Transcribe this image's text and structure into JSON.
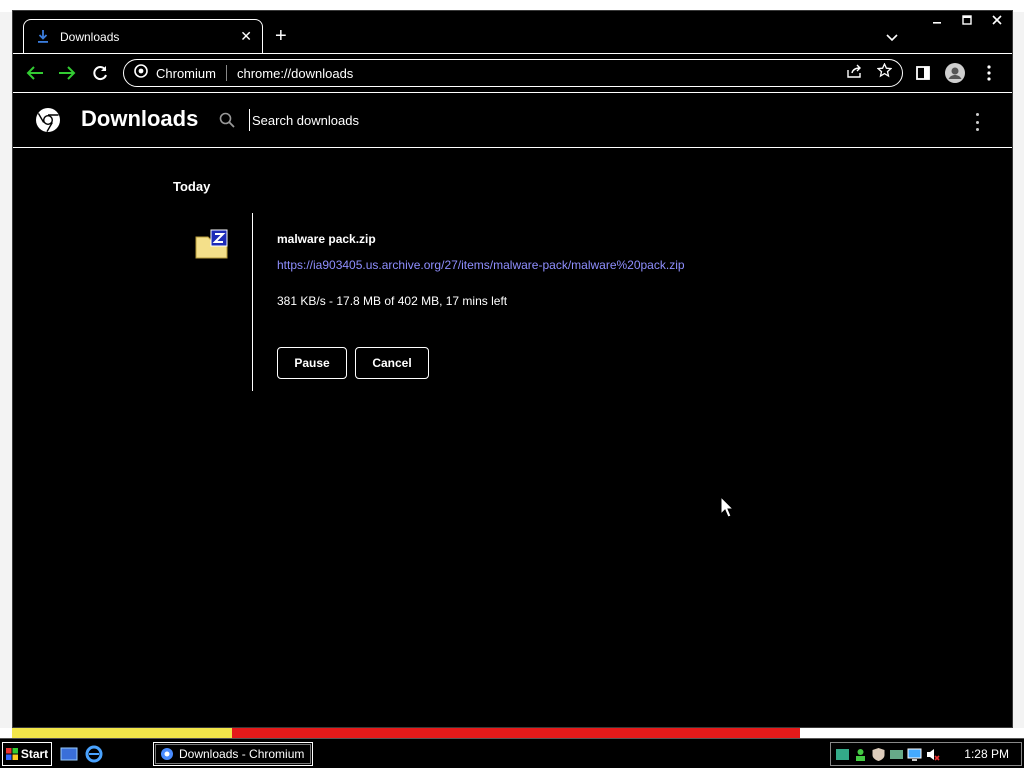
{
  "browser": {
    "tab_title": "Downloads",
    "site_name": "Chromium",
    "url": "chrome://downloads"
  },
  "downloads_page": {
    "title": "Downloads",
    "search_placeholder": "Search downloads",
    "date_group": "Today",
    "items": [
      {
        "file_name": "malware pack.zip",
        "url": "https://ia903405.us.archive.org/27/items/malware-pack/malware%20pack.zip",
        "progress": "381 KB/s - 17.8 MB of 402 MB, 17 mins left",
        "pause_label": "Pause",
        "cancel_label": "Cancel"
      }
    ]
  },
  "taskbar": {
    "start_label": "Start",
    "task_label": "Downloads - Chromium",
    "clock": "1:28 PM"
  },
  "colors": {
    "background": "#000000",
    "foreground": "#ffffff",
    "link": "#8f8fff",
    "nav_arrow": "#33cc33",
    "download_icon": "#3b7ddd"
  },
  "icons": {
    "tab": "download-arrow",
    "file": "zip-archive",
    "search": "magnifier",
    "menu": "three-dot-vertical"
  }
}
